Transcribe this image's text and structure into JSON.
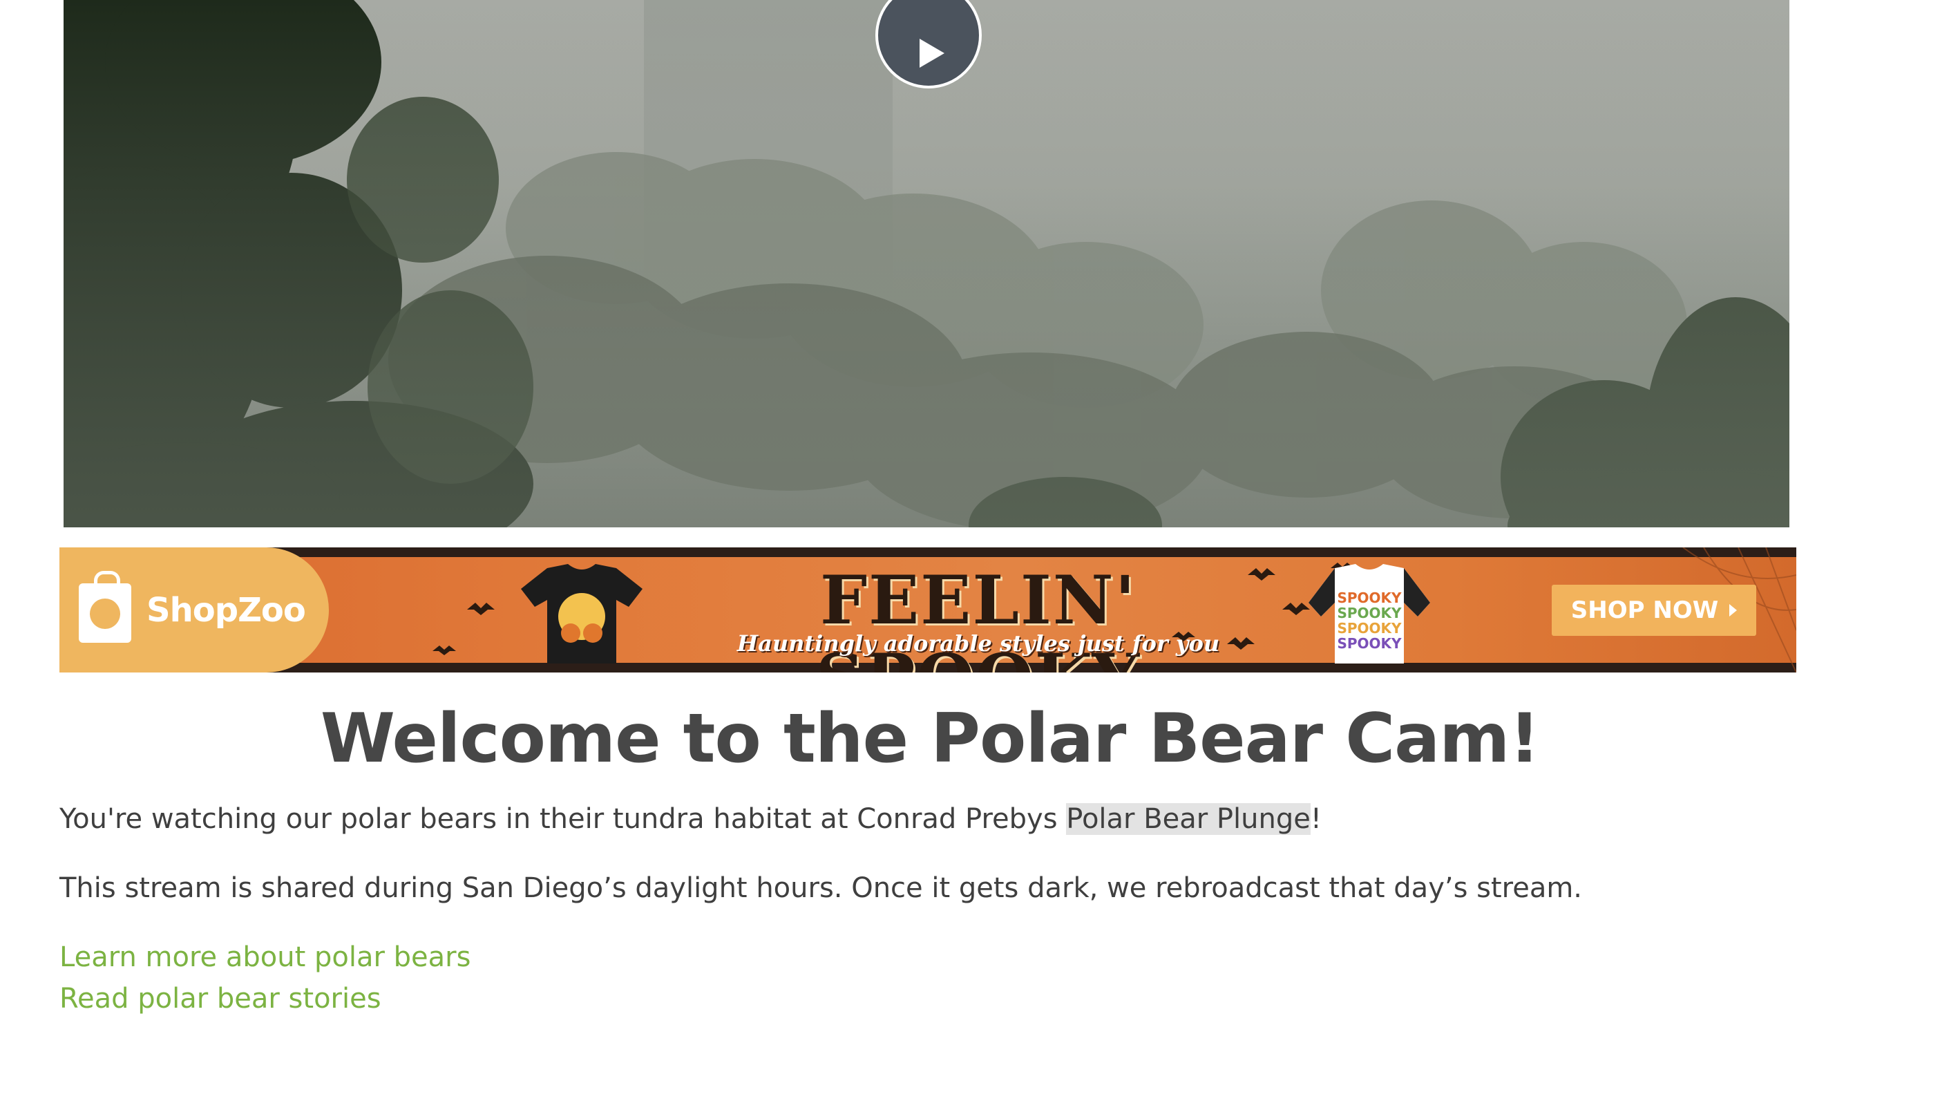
{
  "video": {
    "play_icon": "play-icon"
  },
  "banner": {
    "brand": "ShopZoo",
    "headline": "FEELIN' SPOOKY",
    "subhead": "Hauntingly adorable styles just for you",
    "cta": "SHOP NOW",
    "accent": "#e17a3a",
    "button_color": "#f2b35c"
  },
  "content": {
    "title": "Welcome to the Polar Bear Cam!",
    "p1_before": "You're watching our polar bears in their tundra habitat at Conrad Prebys ",
    "p1_link": "Polar Bear Plunge",
    "p1_after": "!",
    "p2": "This stream is shared during San Diego’s daylight hours. Once it gets dark, we rebroadcast that day’s stream.",
    "link1": "Learn more about polar bears",
    "link2": "Read polar bear stories",
    "link_color": "#7cb342"
  }
}
